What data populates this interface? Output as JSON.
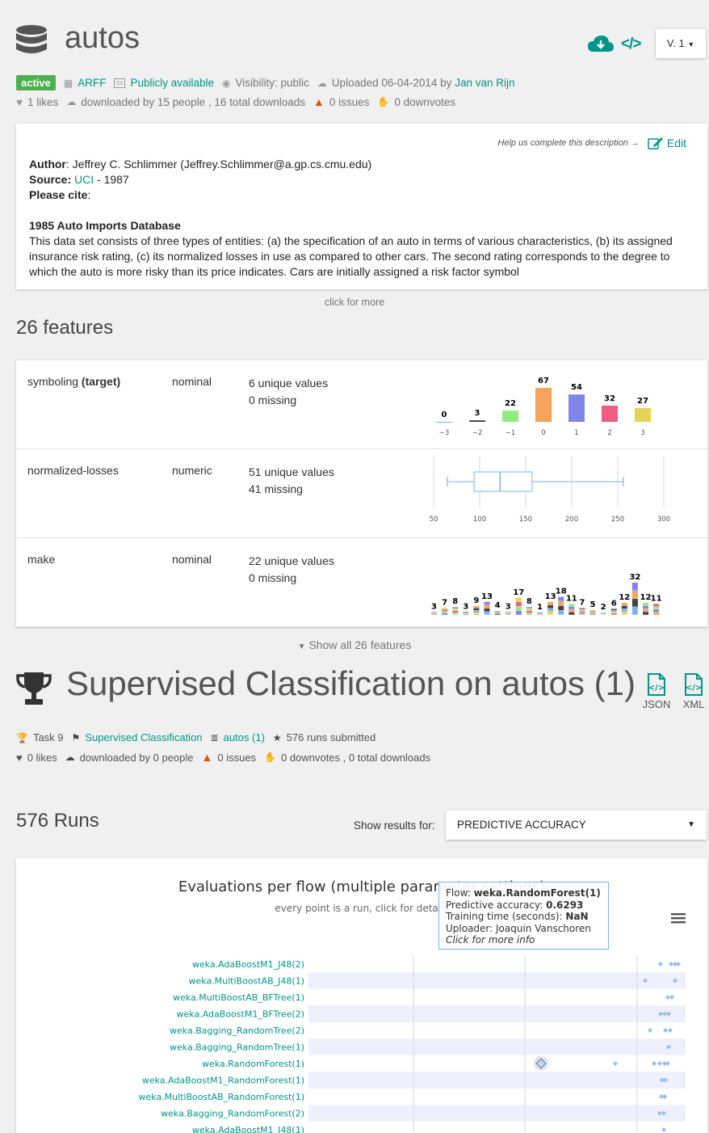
{
  "dataset": {
    "title": "autos",
    "version": "V. 1",
    "status": "active",
    "format": "ARFF",
    "license": "Publicly available",
    "visibility": "Visibility: public",
    "uploaded": "Uploaded 06-04-2014 by",
    "uploader": "Jan van Rijn",
    "likes": "1 likes",
    "downloads": "downloaded by 15 people , 16 total downloads",
    "issues": "0 issues",
    "downvotes": "0 downvotes"
  },
  "description": {
    "help_text": "Help us complete this description →",
    "edit_label": "Edit",
    "author_label": "Author",
    "author_value": ": Jeffrey C. Schlimmer (Jeffrey.Schlimmer@a.gp.cs.cmu.edu)",
    "source_label": "Source",
    "source_link": "UCI",
    "source_year": " - 1987",
    "cite_label": "Please cite",
    "cite_colon": ":",
    "heading": "1985 Auto Imports Database",
    "paragraph": "This data set consists of three types of entities: (a) the specification of an auto in terms of various characteristics, (b) its assigned insurance risk rating, (c) its normalized losses in use as compared to other cars. The second rating corresponds to the degree to which the auto is more risky than its price indicates. Cars are initially assigned a risk factor symbol",
    "click_more": "click for more"
  },
  "features_heading": "26 features",
  "features": [
    {
      "name": "symboling",
      "target_label": "(target)",
      "type": "nominal",
      "unique": "6 unique values",
      "missing": "0 missing"
    },
    {
      "name": "normalized-losses",
      "type": "numeric",
      "unique": "51 unique values",
      "missing": "41 missing"
    },
    {
      "name": "make",
      "type": "nominal",
      "unique": "22 unique values",
      "missing": "0 missing"
    }
  ],
  "show_all": "Show all 26 features",
  "task": {
    "title": "Supervised Classification on autos (1)",
    "json_label": "JSON",
    "xml_label": "XML",
    "task_id": "Task 9",
    "task_type": "Supervised Classification",
    "dataset_link": "autos (1)",
    "runs_submitted": "576 runs submitted",
    "likes": "0 likes",
    "downloads": "downloaded by 0 people",
    "issues": "0 issues",
    "downvotes_downloads": "0 downvotes , 0 total downloads"
  },
  "runs_heading": "576 Runs",
  "results_label": "Show results for:",
  "results_select": "PREDICTIVE ACCURACY",
  "eval_chart": {
    "title": "Evaluations per flow (multiple parameter settings)",
    "subtitle": "every point is a run, click for details",
    "flows": [
      "weka.AdaBoostM1_J48(2)",
      "weka.MultiBoostAB_J48(1)",
      "weka.MultiBoostAB_BFTree(1)",
      "weka.AdaBoostM1_BFTree(2)",
      "weka.Bagging_RandomTree(2)",
      "weka.Bagging_RandomTree(1)",
      "weka.RandomForest(1)",
      "weka.AdaBoostM1_RandomForest(1)",
      "weka.MultiBoostAB_RandomForest(1)",
      "weka.Bagging_RandomForest(2)",
      "weka.AdaBoostM1_J48(1)"
    ],
    "tooltip": {
      "flow_label": "Flow: ",
      "flow_value": "weka.RandomForest(1)",
      "acc_label": "Predictive accuracy: ",
      "acc_value": "0.6293",
      "time_label": "Training time (seconds): ",
      "time_value": "NaN",
      "uploader": "Uploader: Joaquin Vanschoren",
      "more": "Click for more info"
    }
  },
  "chart_data": [
    {
      "type": "bar",
      "categories": [
        "−3",
        "−2",
        "−1",
        "0",
        "1",
        "2",
        "3"
      ],
      "values": [
        0,
        3,
        22,
        67,
        54,
        32,
        27
      ],
      "colors": [
        "#7cb5ec",
        "#434348",
        "#90ed7d",
        "#f7a35c",
        "#8085e9",
        "#f15c80",
        "#e4d354"
      ],
      "ylim": [
        0,
        67
      ]
    },
    {
      "type": "box",
      "x_ticks": [
        "50",
        "100",
        "150",
        "200",
        "250",
        "300"
      ],
      "xlim": [
        50,
        300
      ],
      "min": 65,
      "q1": 94,
      "median": 122,
      "q3": 157,
      "max": 256
    },
    {
      "type": "bar",
      "stacked": true,
      "values": [
        3,
        7,
        8,
        3,
        9,
        13,
        4,
        3,
        17,
        8,
        1,
        13,
        18,
        11,
        7,
        5,
        2,
        6,
        12,
        32,
        12,
        11
      ],
      "ylim": [
        0,
        32
      ]
    }
  ]
}
